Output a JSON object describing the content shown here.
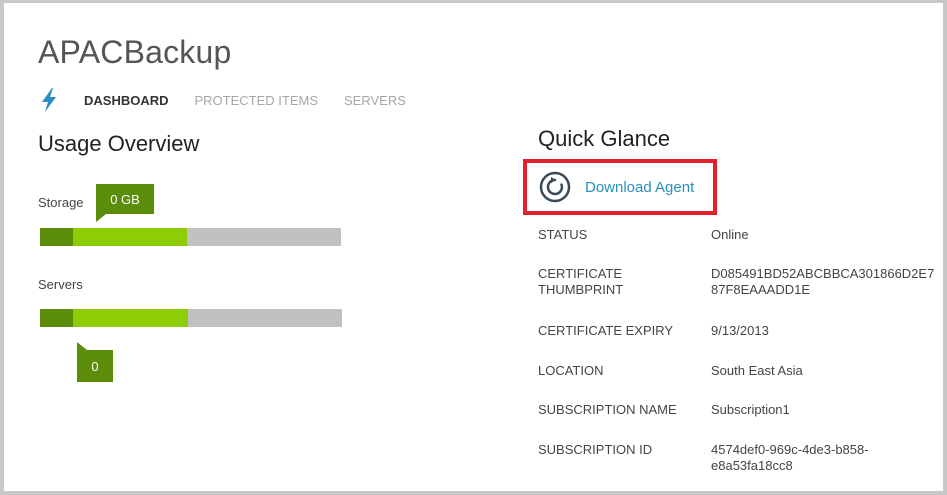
{
  "app": {
    "title": "APACBackup"
  },
  "nav": {
    "tabs": [
      {
        "label": "DASHBOARD",
        "active": true
      },
      {
        "label": "PROTECTED ITEMS",
        "active": false
      },
      {
        "label": "SERVERS",
        "active": false
      }
    ]
  },
  "usage": {
    "title": "Usage Overview",
    "storage": {
      "label": "Storage",
      "value_label": "0 GB",
      "dark_fraction": 0.11,
      "light_fraction": 0.38
    },
    "servers": {
      "label": "Servers",
      "value_label": "0",
      "dark_fraction": 0.11,
      "light_fraction": 0.38
    }
  },
  "glance": {
    "title": "Quick Glance",
    "download_label": "Download Agent",
    "fields": [
      {
        "key": "STATUS",
        "value": "Online"
      },
      {
        "key": "CERTIFICATE THUMBPRINT",
        "value": "D085491BD52ABCBBCA301866D2E787F8EAAADD1E"
      },
      {
        "key": "CERTIFICATE EXPIRY",
        "value": "9/13/2013"
      },
      {
        "key": "LOCATION",
        "value": "South East Asia"
      },
      {
        "key": "SUBSCRIPTION NAME",
        "value": "Subscription1"
      },
      {
        "key": "SUBSCRIPTION ID",
        "value": "4574def0-969c-4de3-b858-e8a53fa18cc8"
      }
    ]
  },
  "colors": {
    "accent_blue": "#2a8fbd",
    "bar_dark": "#5b8c0a",
    "bar_light": "#8ecc05",
    "bar_track": "#c1c1c1",
    "highlight": "#e3202b"
  },
  "icons": {
    "nav": "lightning-bolt-icon",
    "download": "refresh-circle-icon"
  }
}
